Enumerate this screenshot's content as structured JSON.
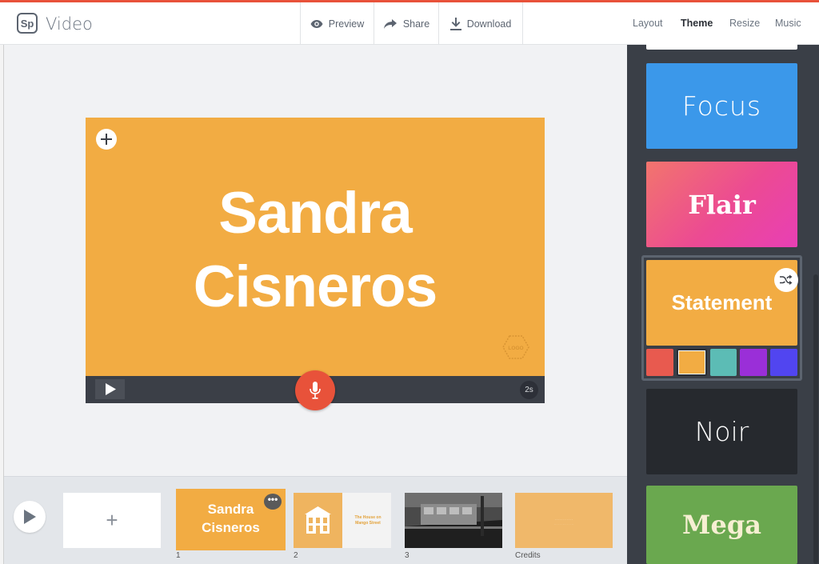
{
  "app": {
    "logo": "Sp",
    "title": "Video"
  },
  "header": {
    "preview": "Preview",
    "share": "Share",
    "download": "Download",
    "tabs": [
      "Layout",
      "Theme",
      "Resize",
      "Music"
    ],
    "active_tab": "Theme"
  },
  "slide": {
    "title_line1": "Sandra",
    "title_line2": "Cisneros",
    "logo_badge": "LOGO",
    "duration": "2s"
  },
  "timeline": {
    "add_label": "+",
    "more": "•••",
    "thumbs": [
      {
        "num": "1",
        "title_line1": "Sandra",
        "title_line2": "Cisneros"
      },
      {
        "num": "2",
        "title": "The House on Mango Street"
      },
      {
        "num": "3"
      },
      {
        "num": "Credits"
      }
    ]
  },
  "themes": {
    "items": [
      "Focus",
      "Flair",
      "Statement",
      "Noir",
      "Mega"
    ],
    "selected": "Statement",
    "swatches": [
      "#e85a4f",
      "#f2ac43",
      "#5cbcb5",
      "#9a2fd8",
      "#5145f0"
    ],
    "selected_swatch": 1
  },
  "colors": {
    "accent": "#e8523a",
    "slide_bg": "#f2ac43",
    "sidebar_bg": "#3a3f47"
  },
  "icons": {
    "preview": "eye-icon",
    "share": "share-arrow-icon",
    "download": "download-icon",
    "add": "plus-icon",
    "play": "play-icon",
    "record": "microphone-icon",
    "shuffle": "shuffle-icon"
  }
}
